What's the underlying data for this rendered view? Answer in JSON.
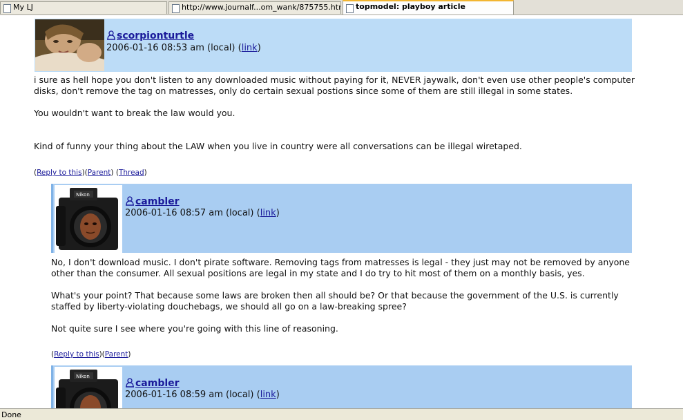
{
  "tabs": [
    {
      "label": "My LJ"
    },
    {
      "label": "http://www.journalf...om_wank/875755.html"
    },
    {
      "label": "topmodel: playboy article"
    }
  ],
  "comments": [
    {
      "username": "scorpionturtle",
      "date": "2006-01-16 08:53 am (local)",
      "link_label": "link",
      "paragraphs": [
        "i sure as hell hope you don't listen to any downloaded music without paying for it, NEVER jaywalk, don't even use other people's computer disks, don't remove the tag on matresses, only do certain sexual postions since some of them are still illegal in some states.",
        "You wouldn't want to break the law would you.",
        "Kind of funny your thing about the LAW when you live in country were all conversations can be illegal wiretaped."
      ],
      "actions": {
        "reply": "Reply to this",
        "parent": "Parent",
        "thread": "Thread"
      }
    },
    {
      "username": "cambler",
      "date": "2006-01-16 08:57 am (local)",
      "link_label": "link",
      "paragraphs": [
        "No, I don't download music. I don't pirate software. Removing tags from matresses is legal - they just may not be removed by anyone other than the consumer. All sexual positions are legal in my state and I do try to hit most of them on a monthly basis, yes.",
        "What's your point? That because some laws are broken then all should be? Or that because the government of the U.S. is currently staffed by liberty-violating douchebags, we should all go on a law-breaking spree?",
        "Not quite sure I see where you're going with this line of reasoning."
      ],
      "actions": {
        "reply": "Reply to this",
        "parent": "Parent"
      }
    },
    {
      "username": "cambler",
      "date": "2006-01-16 08:59 am (local)",
      "link_label": "link"
    }
  ],
  "status": {
    "text": "Done"
  },
  "colors": {
    "header_bg_1": "#bcdcf7",
    "header_bg_2": "#a9cdf2",
    "link": "#1a1a9a"
  }
}
